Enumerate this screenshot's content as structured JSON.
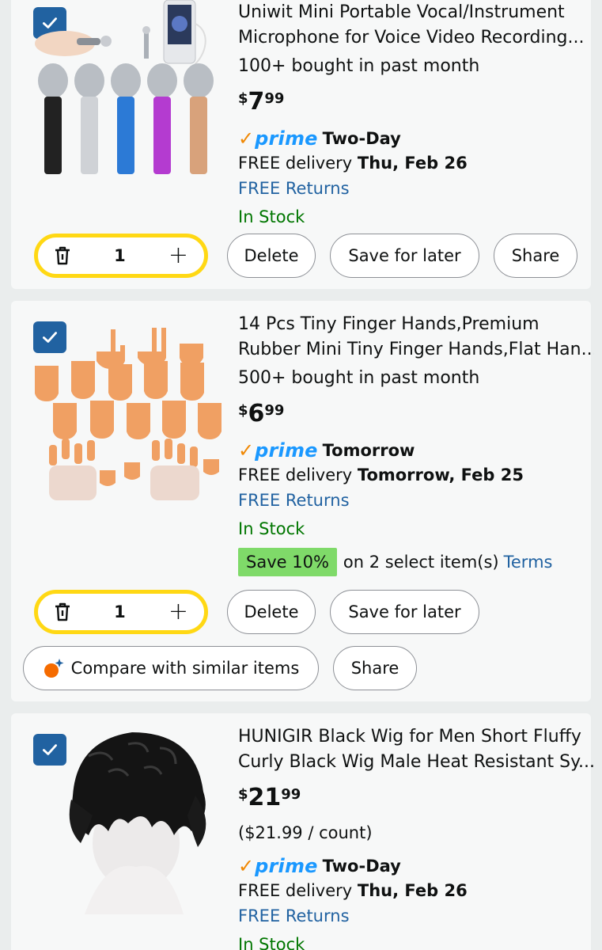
{
  "colors": {
    "checkbox": "#2162a1",
    "link": "#2162a1",
    "in_stock": "#007600",
    "prime_blue": "#1a98ff",
    "prime_check": "#f08804",
    "qty_border": "#ffd814",
    "save_badge": "#7fda69"
  },
  "items": [
    {
      "title_line1": "Uniwit Mini Portable Vocal/Instrument",
      "title_line2": "Microphone for Voice Video Recording...",
      "bought": "100+ bought in past month",
      "price_symbol": "$",
      "price_whole": "7",
      "price_fraction": "99",
      "prime_check": "✓",
      "prime_label": "prime",
      "prime_speed": "Two-Day",
      "delivery_prefix": "FREE delivery",
      "delivery_date": "Thu, Feb 26",
      "returns": "FREE Returns",
      "stock": "In Stock",
      "quantity": "1",
      "delete_label": "Delete",
      "save_label": "Save for later",
      "share_label": "Share",
      "checked": true
    },
    {
      "title_line1": "14 Pcs Tiny Finger Hands,Premium",
      "title_line2": "Rubber Mini Tiny Finger Hands,Flat Han...",
      "bought": "500+ bought in past month",
      "price_symbol": "$",
      "price_whole": "6",
      "price_fraction": "99",
      "prime_check": "✓",
      "prime_label": "prime",
      "prime_speed": "Tomorrow",
      "delivery_prefix": "FREE delivery",
      "delivery_date": "Tomorrow, Feb 25",
      "returns": "FREE Returns",
      "stock": "In Stock",
      "promo_badge": "Save 10%",
      "promo_text": "on 2 select item(s)",
      "promo_terms": "Terms",
      "quantity": "1",
      "delete_label": "Delete",
      "save_label": "Save for later",
      "compare_label": "Compare with similar items",
      "share_label": "Share",
      "checked": true
    },
    {
      "title_line1": "HUNIGIR Black Wig for Men Short Fluffy",
      "title_line2": "Curly Black Wig Male Heat Resistant Sy...",
      "price_symbol": "$",
      "price_whole": "21",
      "price_fraction": "99",
      "unit_price": "($21.99 / count)",
      "prime_check": "✓",
      "prime_label": "prime",
      "prime_speed": "Two-Day",
      "delivery_prefix": "FREE delivery",
      "delivery_date": "Thu, Feb 26",
      "returns": "FREE Returns",
      "stock": "In Stock",
      "checked": true
    }
  ]
}
